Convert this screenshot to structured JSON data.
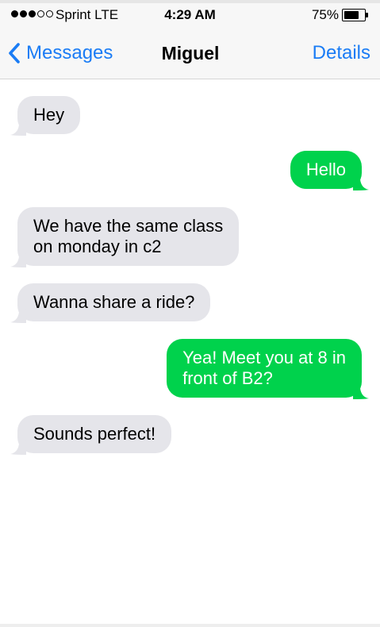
{
  "status_bar": {
    "carrier": "Sprint",
    "network": "LTE",
    "carrier_text": "Sprint  LTE",
    "signal_bars_filled": 3,
    "signal_bars_total": 5,
    "time": "4:29 AM",
    "battery_percent": "75%",
    "battery_level": 0.75
  },
  "nav": {
    "back_label": "Messages",
    "title": "Miguel",
    "details_label": "Details",
    "accent_color": "#1a7cf5"
  },
  "thread": {
    "incoming_color": "#e5e5ea",
    "outgoing_color": "#00d24c",
    "messages": [
      {
        "direction": "incoming",
        "lines": [
          "Hey"
        ]
      },
      {
        "direction": "outgoing",
        "lines": [
          "Hello"
        ]
      },
      {
        "direction": "incoming",
        "lines": [
          "We have the same class",
          "on monday in c2"
        ]
      },
      {
        "direction": "incoming",
        "lines": [
          "Wanna share a ride?"
        ]
      },
      {
        "direction": "outgoing",
        "lines": [
          "Yea! Meet you at 8 in",
          "front of B2?"
        ]
      },
      {
        "direction": "incoming",
        "lines": [
          "Sounds perfect!"
        ]
      }
    ]
  }
}
